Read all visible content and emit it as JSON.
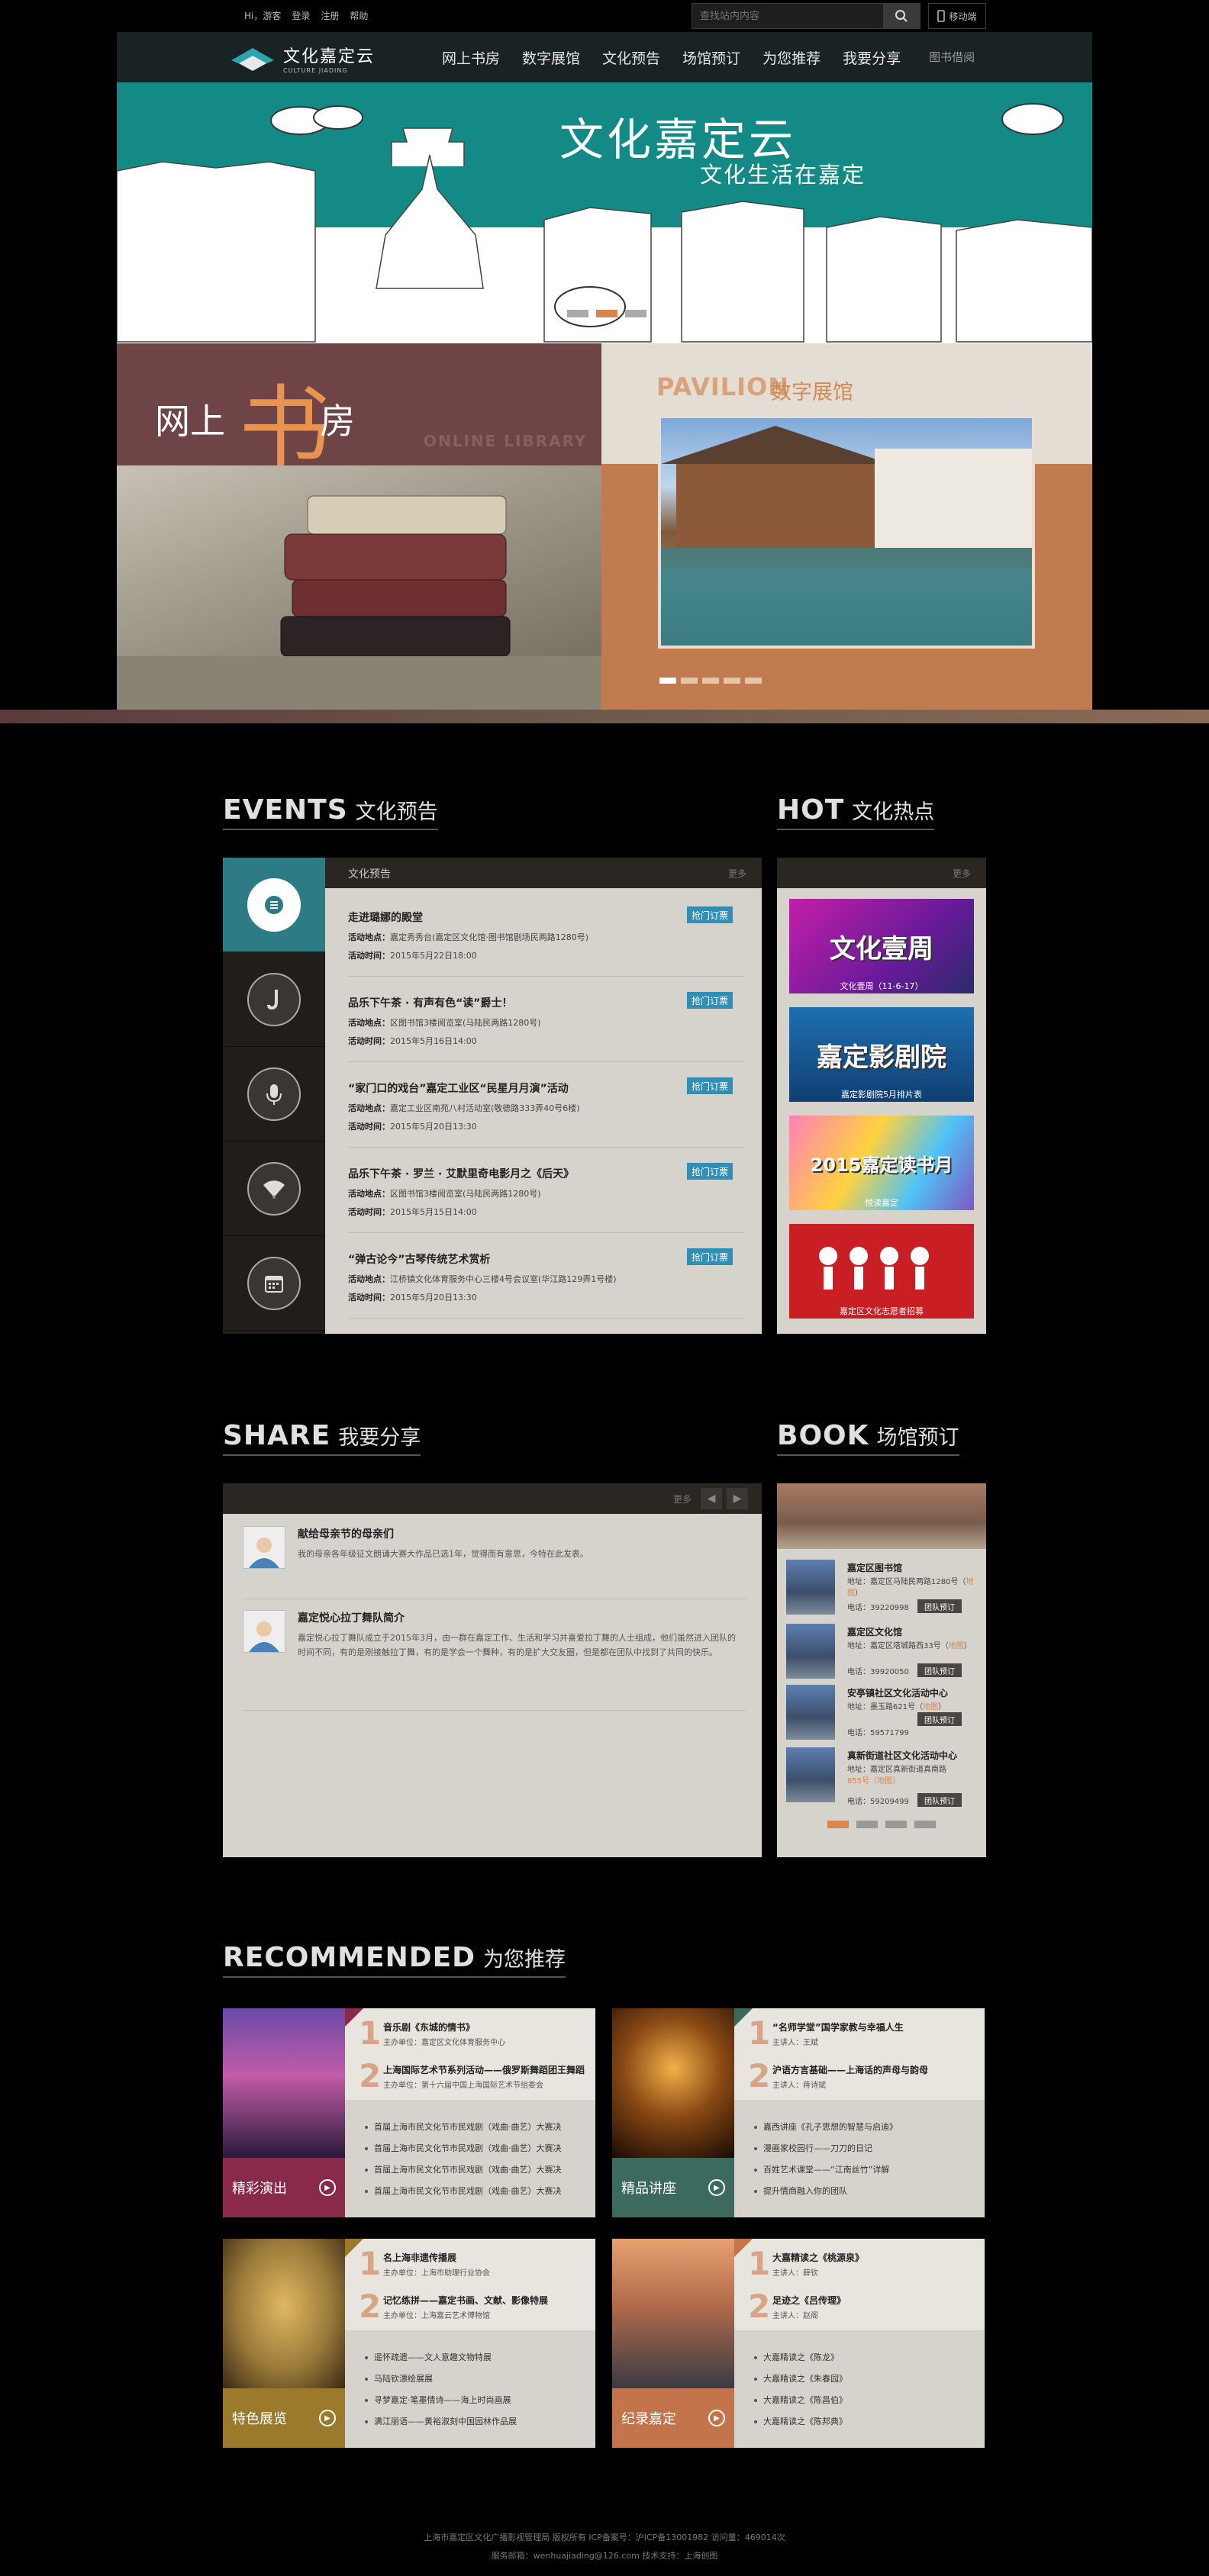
{
  "topbar": {
    "links": [
      "Hi，游客",
      "登录",
      "注册",
      "帮助"
    ],
    "search_placeholder": "查找站内内容",
    "mobile": "移动端"
  },
  "nav": {
    "logo": "文化嘉定云",
    "logo_sub": "CULTURE JIADING",
    "items": [
      "网上书房",
      "数字展馆",
      "文化预告",
      "场馆预订",
      "为您推荐",
      "我要分享"
    ],
    "extra": "图书借阅"
  },
  "banner": {
    "title": "文化嘉定云",
    "subtitle": "文化生活在嘉定"
  },
  "library_tile": {
    "wang": "网上",
    "shu": "书",
    "fang": "房",
    "en": "ONLINE LIBRARY"
  },
  "pavilion_tile": {
    "en": "PAVILION",
    "cn": "数字展馆"
  },
  "events": {
    "en": "EVENTS",
    "cn": "文化预告",
    "panel_title": "文化预告",
    "more": "更多",
    "items": [
      {
        "title": "走进璐娜的殿堂",
        "place": "嘉定秀秀台(嘉定区文化馆·图书馆剧场民两路1280号)",
        "time": "2015年5月22日18:00",
        "btn": "抢门订票"
      },
      {
        "title": "品乐下午茶 · 有声有色“读”爵士！",
        "place": "区图书馆3楼阅览室(马陆民两路1280号)",
        "time": "2015年5月16日14:00",
        "btn": "抢门订票"
      },
      {
        "title": "“家门口的戏台”嘉定工业区“民星月月演”活动",
        "place": "嘉定工业区南苑八村活动室(敬德路333弄40号6楼)",
        "time": "2015年5月20日13:30",
        "btn": "抢门订票"
      },
      {
        "title": "品乐下午茶 · 罗兰 · 艾默里奇电影月之《后天》",
        "place": "区图书馆3楼阅览室(马陆民两路1280号)",
        "time": "2015年5月15日14:00",
        "btn": "抢门订票"
      },
      {
        "title": "“弹古论今”古琴传统艺术赏析",
        "place": "江桥镇文化体育服务中心三楼4号会议室(华江路129弄1号楼)",
        "time": "2015年5月20日13:30",
        "btn": "抢门订票"
      }
    ],
    "label_place": "活动地点：",
    "label_time": "活动时间："
  },
  "hot": {
    "en": "HOT",
    "cn": "文化热点",
    "more": "更多",
    "items": [
      {
        "big": "文化壹周",
        "cap": "文化壹周（11-6-17）"
      },
      {
        "big": "嘉定影剧院",
        "cap": "嘉定影剧院5月排片表"
      },
      {
        "big": "2015嘉定读书月",
        "cap": "悦读嘉定"
      },
      {
        "big": "",
        "cap": "嘉定区文化志愿者招募"
      }
    ]
  },
  "share": {
    "en": "SHARE",
    "cn": "我要分享",
    "more": "更多",
    "posts": [
      {
        "title": "献给母亲节的母亲们",
        "body": "我的母亲各年级征文朗诵大赛大作品已选1年，觉得而有意思，今特在此发表。"
      },
      {
        "title": "嘉定悦心拉丁舞队简介",
        "body": "嘉定悦心拉丁舞队成立于2015年3月，由一群在嘉定工作、生活和学习并喜爱拉丁舞的人士组成，他们虽然进入团队的时间不同，有的是刚接触拉丁舞，有的是学会一个舞种，有的是扩大交友圈，但是都在团队中找到了共同的快乐。"
      }
    ]
  },
  "book": {
    "en": "BOOK",
    "cn": "场馆预订",
    "venues": [
      {
        "name": "嘉定区图书馆",
        "addr": "地址：嘉定区马陆民两路1280号（",
        "map": "地图",
        "tel": "电话：39220998",
        "btn": "团队预订"
      },
      {
        "name": "嘉定区文化馆",
        "addr": "地址：嘉定区塔城路西33号（",
        "map": "地图",
        "tel": "电话：39920050",
        "btn": "团队预订"
      },
      {
        "name": "安亭镇社区文化活动中心",
        "addr": "地址：墨玉路621号（",
        "map": "地图",
        "tel": "电话：59571799",
        "btn": "团队预订"
      },
      {
        "name": "真新街道社区文化活动中心",
        "addr": "地址：嘉定区真新街道真南路",
        "map": "855号（地图）",
        "tel": "电话：59209499",
        "btn": "团队预订"
      }
    ]
  },
  "recommended": {
    "en": "RECOMMENDED",
    "cn": "为您推荐",
    "cards": [
      {
        "label": "精彩演出",
        "color": "#8a2a4a",
        "top": [
          {
            "num": "1",
            "title": "音乐剧《东城的情书》",
            "sub": "主办单位：嘉定区文化体育服务中心"
          },
          {
            "num": "2",
            "title": "上海国际艺术节系列活动——俄罗斯舞蹈团王舞蹈",
            "sub": "主办单位：第十六届中国上海国际艺术节组委会"
          }
        ],
        "list": [
          "首届上海市民文化节市民戏剧（戏曲·曲艺）大赛决",
          "首届上海市民文化节市民戏剧（戏曲·曲艺）大赛决",
          "首届上海市民文化节市民戏剧（戏曲·曲艺）大赛决",
          "首届上海市民文化节市民戏剧（戏曲·曲艺）大赛决"
        ]
      },
      {
        "label": "精品讲座",
        "color": "#3d6a5e",
        "top": [
          {
            "num": "1",
            "title": "“名师学堂”国学家教与幸福人生",
            "sub": "主讲人：王斌"
          },
          {
            "num": "2",
            "title": "沪语方言基础——上海话的声母与韵母",
            "sub": "主讲人：蒋诗斌"
          }
        ],
        "list": [
          "嘉西讲座《孔子思想的智慧与启迪》",
          "漫画家校园行——刀刀的日记",
          "百姓艺术课堂——“江南丝竹”详解",
          "提升情商融入你的团队"
        ]
      },
      {
        "label": "特色展览",
        "color": "#9b7a2c",
        "top": [
          {
            "num": "1",
            "title": "名上海非遗传播展",
            "sub": "主办单位：上海市助理行业协会"
          },
          {
            "num": "2",
            "title": "记忆练拼——嘉定书画、文献、影像特展",
            "sub": "主办单位：上海嘉云艺术博物馆"
          }
        ],
        "list": [
          "遥怀疏遗——文人意趣文物特展",
          "马陆钦漂绘展展",
          "寻梦嘉定·笔墨情诗——海上时尚画展",
          "满江丽语——黄裕淑刻中国园林作品展"
        ]
      },
      {
        "label": "纪录嘉定",
        "color": "#c4744a",
        "top": [
          {
            "num": "1",
            "title": "大嘉精读之《桃源泉》",
            "sub": "主讲人：薛钦"
          },
          {
            "num": "2",
            "title": "足迹之《吕传理》",
            "sub": "主讲人：赵阁"
          }
        ],
        "list": [
          "大嘉精读之《陈龙》",
          "大嘉精读之《朱春园》",
          "大嘉精读之《陈昌伯》",
          "大嘉精读之《陈邦典》"
        ]
      }
    ]
  },
  "footer": {
    "line1": "上海市嘉定区文化广播影视管理局 版权所有 ICP备案号：沪ICP备13001982 访问量：469014次",
    "line2": "服务邮箱：wenhuajiading@126.com 技术支持：上海创图"
  },
  "colors": {
    "accent_teal": "#148a86",
    "accent_orange": "#d9854c",
    "tag_blue": "#2f8fb7"
  }
}
